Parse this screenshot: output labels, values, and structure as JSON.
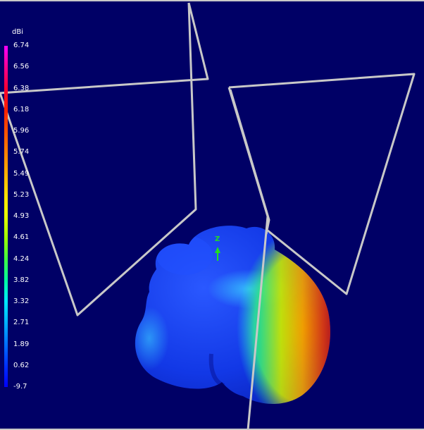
{
  "legend": {
    "unit": "dBi",
    "ticks": [
      "6.74",
      "6.56",
      "6.38",
      "6.18",
      "5.96",
      "5.74",
      "5.49",
      "5.23",
      "4.93",
      "4.61",
      "4.24",
      "3.82",
      "3.32",
      "2.71",
      "1.89",
      "0.62",
      "-9.7"
    ],
    "gradient": [
      "#ff00ff",
      "#ff0090",
      "#ff0030",
      "#ff2000",
      "#ff5000",
      "#ff8000",
      "#ffb000",
      "#ffe000",
      "#e8ff00",
      "#a0ff00",
      "#40ff40",
      "#00ffa0",
      "#00e8ff",
      "#00b0ff",
      "#0070ff",
      "#0030ff",
      "#0000ff"
    ]
  },
  "axis": {
    "z_label": "Z",
    "color": "#22dd22"
  },
  "colors": {
    "background": "#000066",
    "wire": "#c8c8c8",
    "pattern_low": "#1030e0",
    "pattern_high": "#b80020"
  }
}
